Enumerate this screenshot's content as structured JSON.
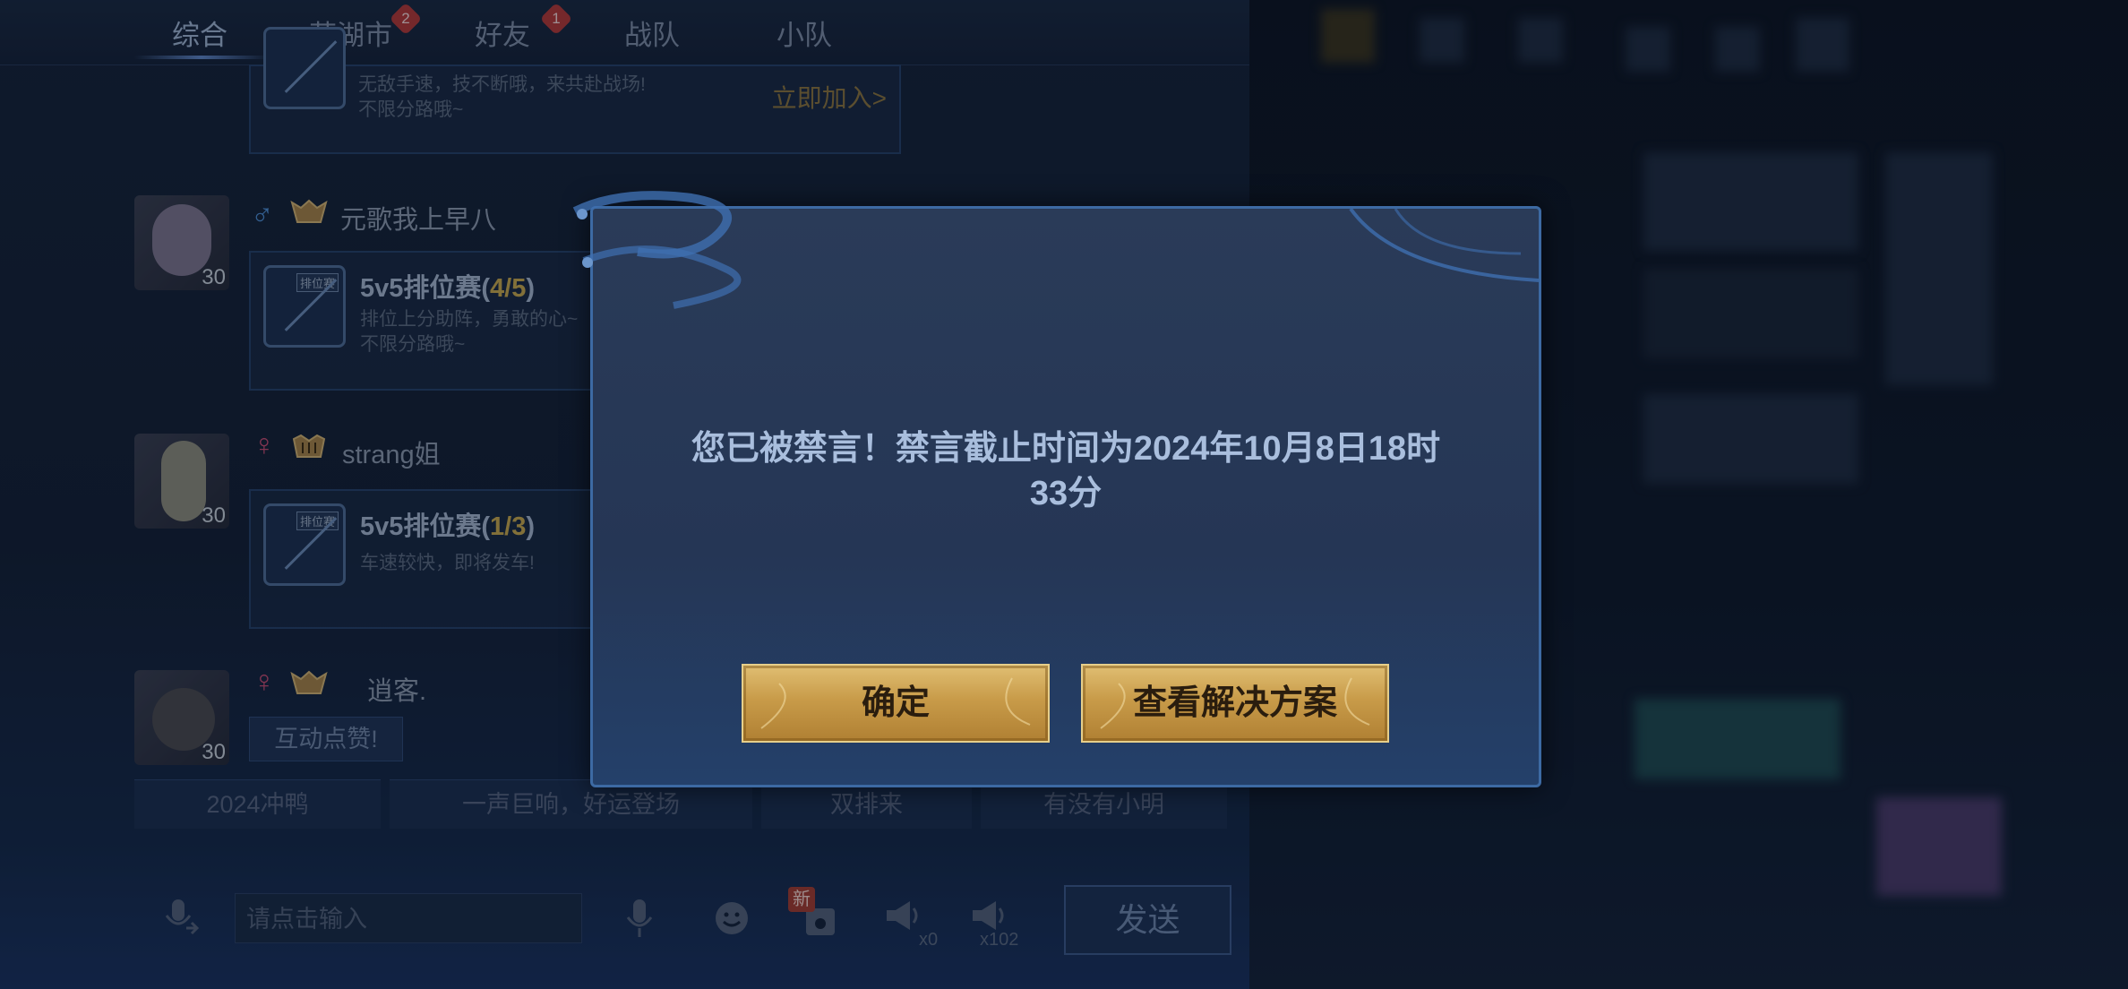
{
  "tabs": [
    {
      "label": "综合",
      "badge": ""
    },
    {
      "label": "芜湖市",
      "badge": "2"
    },
    {
      "label": "好友",
      "badge": "1"
    },
    {
      "label": "战队",
      "badge": ""
    },
    {
      "label": "小队",
      "badge": ""
    }
  ],
  "top_card": {
    "desc_line1": "无敌手速，技不断哦，来共赴战场!",
    "desc_line2": "不限分路哦~",
    "join_label": "立即加入>"
  },
  "posts": [
    {
      "username": "元歌我上早八",
      "gender": "♂",
      "level": "30",
      "rank_tag": "排位赛",
      "title_prefix": "5v5排位赛(",
      "title_count": "4/5",
      "title_suffix": ")",
      "desc_line1": "排位上分助阵，勇敢的心~",
      "desc_line2": "不限分路哦~"
    },
    {
      "username": "strang姐",
      "gender": "♀",
      "level": "30",
      "rank_tag": "排位赛",
      "title_prefix": "5v5排位赛(",
      "title_count": "1/3",
      "title_suffix": ")",
      "desc_line1": "车速较快，即将发车!"
    },
    {
      "username": "逍客.",
      "gender": "♀",
      "level": "30",
      "action_label": "互动点赞!"
    }
  ],
  "quick_phrases": [
    "2024冲鸭",
    "一声巨响，好运登场",
    "双排来",
    "有没有小明"
  ],
  "input": {
    "placeholder": "请点击输入",
    "new_badge": "新",
    "speaker_count_1": "x0",
    "speaker_count_2": "x102",
    "send_label": "发送"
  },
  "dialog": {
    "message_line1": "您已被禁言！禁言截止时间为2024年10月8日18时",
    "message_line2": "33分",
    "confirm_label": "确定",
    "solution_label": "查看解决方案"
  },
  "colors": {
    "dialog_bg": "#283a58",
    "dialog_border": "#3d6aa3",
    "gold_button": "#d2aa5c",
    "male": "#4d8fd6",
    "female": "#c64e73",
    "highlight_count": "#c6a84f"
  }
}
